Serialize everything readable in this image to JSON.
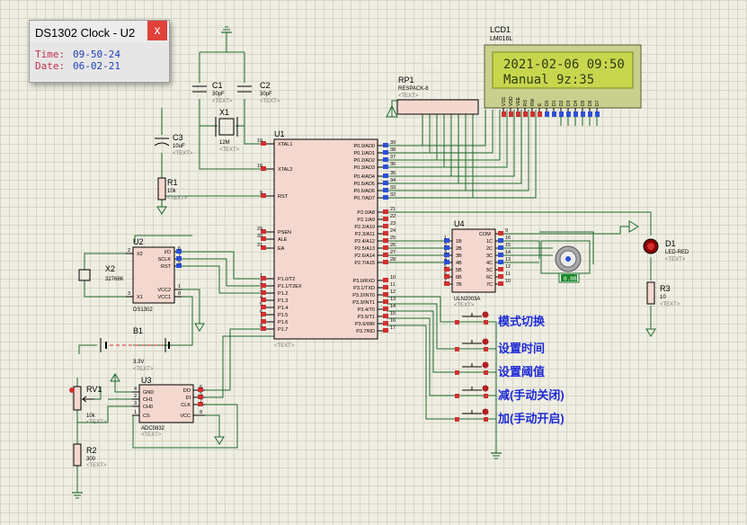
{
  "popup": {
    "title": "DS1302 Clock - U2",
    "close": "x",
    "time_label": "Time:",
    "time_value": "09-50-24",
    "date_label": "Date:",
    "date_value": "06-02-21"
  },
  "lcd": {
    "ref": "LCD1",
    "model": "LM016L",
    "line1": "2021-02-06 09:50",
    "line2": "Manual    9z:35",
    "pins": [
      "VSS",
      "VDD",
      "VEE",
      "RS",
      "RW",
      "E",
      "D0",
      "D1",
      "D2",
      "D3",
      "D4",
      "D5",
      "D6",
      "D7"
    ]
  },
  "rp1": {
    "ref": "RP1",
    "model": "RESPACK-8",
    "text": "<TEXT>"
  },
  "mcu": {
    "ref": "U1",
    "text": "<TEXT>",
    "left_pins": [
      {
        "num": "19",
        "name": "XTAL1"
      },
      {
        "num": "18",
        "name": "XTAL2"
      },
      {
        "num": "9",
        "name": "RST"
      },
      {
        "num": "29",
        "name": "PSEN"
      },
      {
        "num": "30",
        "name": "ALE"
      },
      {
        "num": "31",
        "name": "EA"
      },
      {
        "num": "1",
        "name": "P1.0/T2"
      },
      {
        "num": "2",
        "name": "P1.1/T2EX"
      },
      {
        "num": "3",
        "name": "P1.2"
      },
      {
        "num": "4",
        "name": "P1.3"
      },
      {
        "num": "5",
        "name": "P1.4"
      },
      {
        "num": "6",
        "name": "P1.5"
      },
      {
        "num": "7",
        "name": "P1.6"
      },
      {
        "num": "8",
        "name": "P1.7"
      }
    ],
    "right_pins": [
      {
        "num": "39",
        "name": "P0.0/AD0"
      },
      {
        "num": "38",
        "name": "P0.1/AD1"
      },
      {
        "num": "37",
        "name": "P0.2/AD2"
      },
      {
        "num": "36",
        "name": "P0.3/AD3"
      },
      {
        "num": "35",
        "name": "P0.4/AD4"
      },
      {
        "num": "34",
        "name": "P0.5/AD5"
      },
      {
        "num": "33",
        "name": "P0.6/AD6"
      },
      {
        "num": "32",
        "name": "P0.7/AD7"
      },
      {
        "num": "21",
        "name": "P2.0/A8"
      },
      {
        "num": "22",
        "name": "P2.1/A9"
      },
      {
        "num": "23",
        "name": "P2.2/A10"
      },
      {
        "num": "24",
        "name": "P2.3/A11"
      },
      {
        "num": "25",
        "name": "P2.4/A12"
      },
      {
        "num": "26",
        "name": "P2.5/A13"
      },
      {
        "num": "27",
        "name": "P2.6/A14"
      },
      {
        "num": "28",
        "name": "P2.7/A15"
      },
      {
        "num": "10",
        "name": "P3.0/RXD"
      },
      {
        "num": "11",
        "name": "P3.1/TXD"
      },
      {
        "num": "12",
        "name": "P3.2/INT0"
      },
      {
        "num": "13",
        "name": "P3.3/INT1"
      },
      {
        "num": "14",
        "name": "P3.4/T0"
      },
      {
        "num": "15",
        "name": "P3.5/T1"
      },
      {
        "num": "16",
        "name": "P3.6/WR"
      },
      {
        "num": "17",
        "name": "P3.7/RD"
      }
    ]
  },
  "u2": {
    "ref": "U2",
    "model": "DS1302",
    "pins_left": [
      {
        "num": "2",
        "name": "X2"
      },
      {
        "num": "3",
        "name": "X1"
      }
    ],
    "pins_right": [
      {
        "num": "6",
        "name": "I/O"
      },
      {
        "num": "7",
        "name": "SCLK"
      },
      {
        "num": "5",
        "name": "RST"
      },
      {
        "num": "1",
        "name": "VCC2"
      },
      {
        "num": "8",
        "name": "VCC1"
      }
    ]
  },
  "x2": {
    "ref": "X2",
    "value": "32768K"
  },
  "x1": {
    "ref": "X1",
    "value": "12M",
    "text": "<TEXT>"
  },
  "c1": {
    "ref": "C1",
    "value": "30pF",
    "text": "<TEXT>"
  },
  "c2": {
    "ref": "C2",
    "value": "30pF",
    "text": "<TEXT>"
  },
  "c3": {
    "ref": "C3",
    "value": "10uF",
    "text": "<TEXT>"
  },
  "r1": {
    "ref": "R1",
    "value": "10k",
    "text": "<TEXT>"
  },
  "b1": {
    "ref": "B1",
    "value": "3.3V",
    "text": "<TEXT>"
  },
  "u3": {
    "ref": "U3",
    "model": "ADC0832",
    "text": "<TEXT>",
    "pins_left": [
      {
        "num": "4",
        "name": "GND"
      },
      {
        "num": "2",
        "name": "CH1"
      },
      {
        "num": "3",
        "name": "CH0"
      },
      {
        "num": "1",
        "name": "CS"
      }
    ],
    "pins_right": [
      {
        "num": "6",
        "name": "DO"
      },
      {
        "num": "5",
        "name": "DI"
      },
      {
        "num": "7",
        "name": "CLK"
      },
      {
        "num": "8",
        "name": "VCC"
      }
    ]
  },
  "rv1": {
    "ref": "RV1",
    "value": "10k",
    "text": "<TEXT>"
  },
  "r2": {
    "ref": "R2",
    "value": "300",
    "text": "<TEXT>"
  },
  "u4": {
    "ref": "U4",
    "model": "ULN2003A",
    "text": "<TEXT>",
    "com": "COM",
    "pins_left": [
      {
        "num": "1",
        "name": "1B"
      },
      {
        "num": "2",
        "name": "2B"
      },
      {
        "num": "3",
        "name": "3B"
      },
      {
        "num": "4",
        "name": "4B"
      },
      {
        "num": "5",
        "name": "5B"
      },
      {
        "num": "6",
        "name": "6B"
      },
      {
        "num": "7",
        "name": "7B"
      }
    ],
    "pins_right": [
      {
        "num": "9",
        "name": ""
      },
      {
        "num": "16",
        "name": "1C"
      },
      {
        "num": "15",
        "name": "2C"
      },
      {
        "num": "14",
        "name": "3C"
      },
      {
        "num": "13",
        "name": "4C"
      },
      {
        "num": "12",
        "name": "5C"
      },
      {
        "num": "11",
        "name": "6C"
      },
      {
        "num": "10",
        "name": "7C"
      }
    ]
  },
  "motor": {
    "readout": "0.00"
  },
  "d1": {
    "ref": "D1",
    "model": "LED-RED",
    "text": "<TEXT>"
  },
  "r3": {
    "ref": "R3",
    "value": "10",
    "text": "<TEXT>"
  },
  "buttons": [
    {
      "label": "模式切换"
    },
    {
      "label": "设置时间"
    },
    {
      "label": "设置阈值"
    },
    {
      "label": "减(手动关闭)"
    },
    {
      "label": "加(手动开启)"
    }
  ],
  "colors": {
    "wire": "#1f6b2c",
    "body": "#f4d7ce",
    "outline": "#000000",
    "label": "#1e2bd6",
    "pin_red": "#d23030",
    "pin_blue": "#2c4fd8",
    "lcd_bg": "#c8d64e",
    "lcd_fg": "#2f3a14"
  }
}
